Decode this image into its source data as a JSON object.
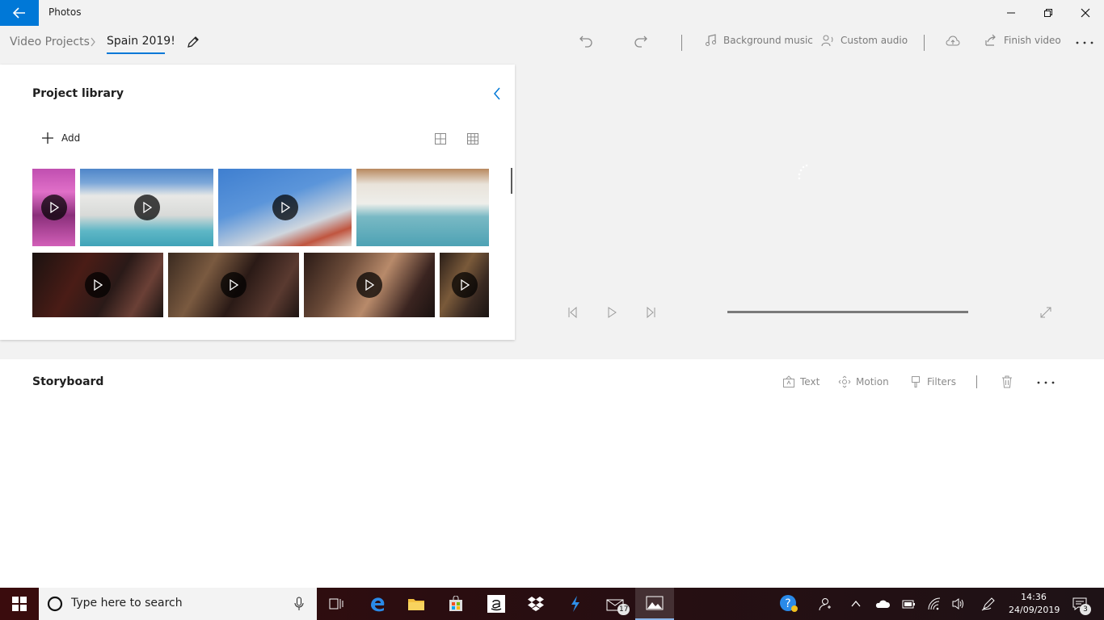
{
  "window": {
    "title": "Photos"
  },
  "breadcrumb": {
    "root": "Video Projects",
    "current": "Spain 2019!"
  },
  "toolbar": {
    "background_music": "Background music",
    "custom_audio": "Custom audio",
    "finish_video": "Finish video"
  },
  "library": {
    "title": "Project library",
    "add_label": "Add"
  },
  "storyboard": {
    "title": "Storyboard",
    "text_label": "Text",
    "motion_label": "Motion",
    "filters_label": "Filters"
  },
  "taskbar": {
    "search_placeholder": "Type here to search",
    "mail_badge": "17",
    "time": "14:36",
    "date": "24/09/2019",
    "notifications_badge": "3"
  },
  "colors": {
    "accent": "#0078d7",
    "taskbar": "#2a0d10"
  }
}
